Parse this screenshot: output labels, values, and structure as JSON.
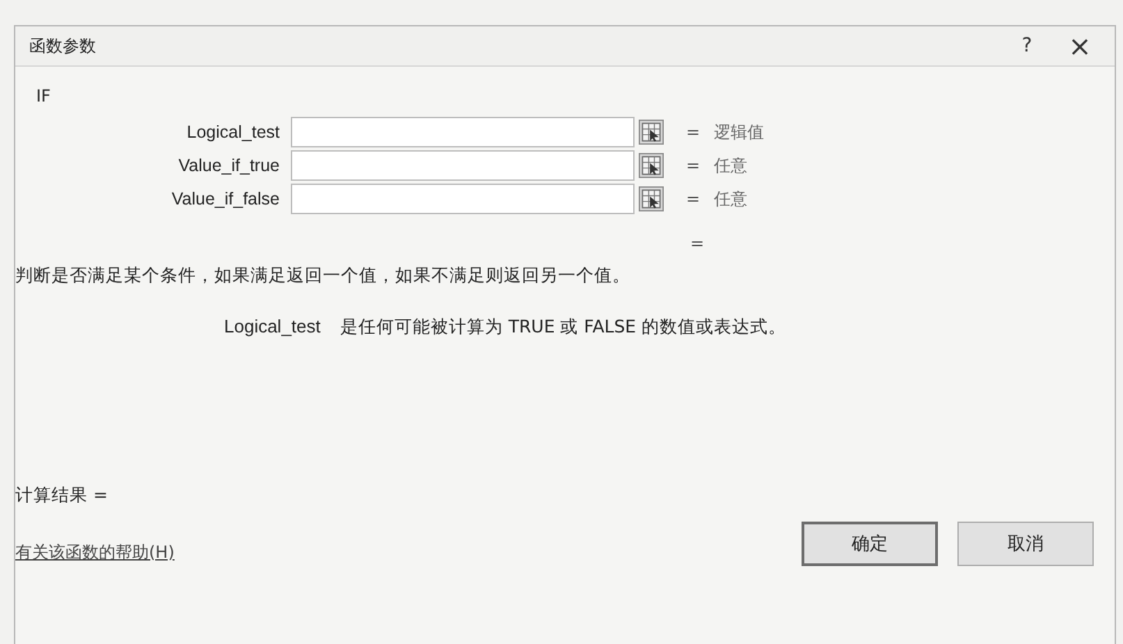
{
  "window": {
    "title": "函数参数",
    "help": "?",
    "close": "×"
  },
  "function_name": "IF",
  "arguments": [
    {
      "label": "Logical_test",
      "result": "逻辑值"
    },
    {
      "label": "Value_if_true",
      "result": "任意"
    },
    {
      "label": "Value_if_false",
      "result": "任意"
    }
  ],
  "equals": "=",
  "result_preview": "=",
  "description": "判断是否满足某个条件，如果满足返回一个值，如果不满足则返回另一个值。",
  "argument_help": {
    "name": "Logical_test",
    "text": "是任何可能被计算为 TRUE 或 FALSE 的数值或表达式。"
  },
  "formula_result": "计算结果 =",
  "help_link": "有关该函数的帮助(H)",
  "buttons": [
    {
      "label": "确定",
      "default": true
    },
    {
      "label": "取消",
      "default": false
    }
  ]
}
